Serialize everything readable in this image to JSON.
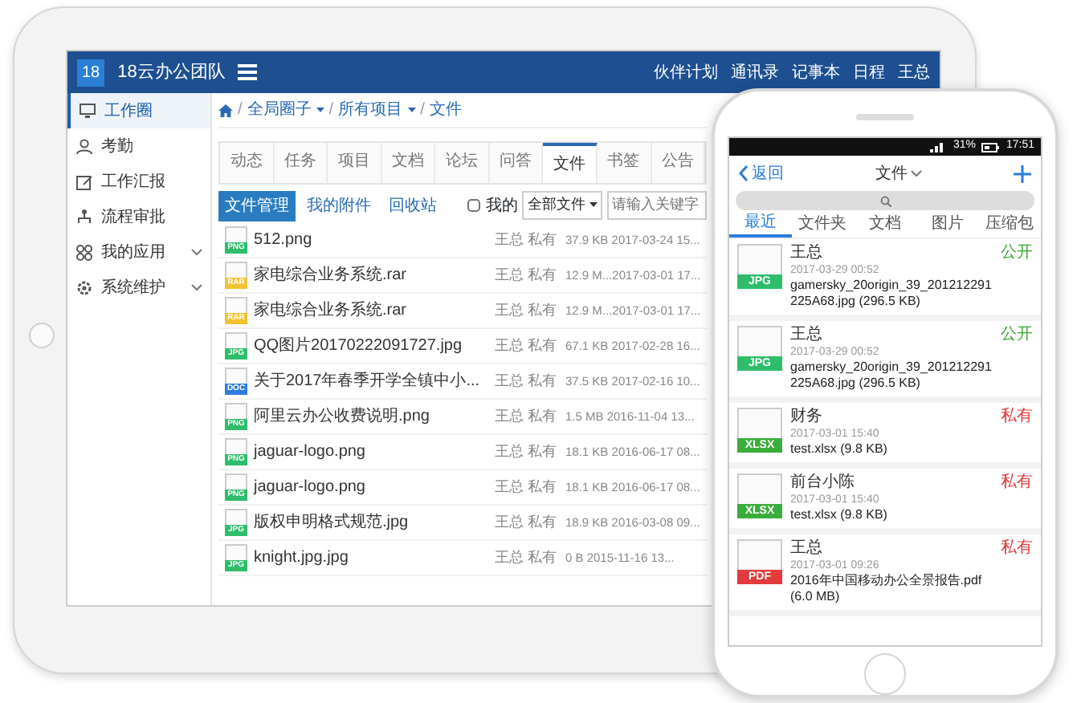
{
  "tablet": {
    "brand": {
      "logo": "18",
      "name": "18云办公团队"
    },
    "nav_links": [
      "伙伴计划",
      "通讯录",
      "记事本",
      "日程",
      "王总"
    ],
    "sidebar": [
      {
        "kind": "monitor",
        "label": "工作圈",
        "selected": true,
        "expandable": false
      },
      {
        "kind": "person",
        "label": "考勤",
        "selected": false,
        "expandable": false
      },
      {
        "kind": "edit",
        "label": "工作汇报",
        "selected": false,
        "expandable": false
      },
      {
        "kind": "flow",
        "label": "流程审批",
        "selected": false,
        "expandable": false
      },
      {
        "kind": "apps",
        "label": "我的应用",
        "selected": false,
        "expandable": true
      },
      {
        "kind": "gear",
        "label": "系统维护",
        "selected": false,
        "expandable": true
      }
    ],
    "breadcrumb_separator": "/",
    "breadcrumb": [
      {
        "label": "全局圈子",
        "dropdown": true
      },
      {
        "label": "所有项目",
        "dropdown": true
      },
      {
        "label": "文件",
        "dropdown": false
      }
    ],
    "tabs": [
      {
        "label": "动态",
        "selected": false
      },
      {
        "label": "任务",
        "selected": false
      },
      {
        "label": "项目",
        "selected": false
      },
      {
        "label": "文档",
        "selected": false
      },
      {
        "label": "论坛",
        "selected": false
      },
      {
        "label": "问答",
        "selected": false
      },
      {
        "label": "文件",
        "selected": true
      },
      {
        "label": "书签",
        "selected": false
      },
      {
        "label": "公告",
        "selected": false
      }
    ],
    "toolbar": {
      "buttons": [
        {
          "label": "文件管理",
          "selected": true
        },
        {
          "label": "我的附件",
          "selected": false
        },
        {
          "label": "回收站",
          "selected": false
        }
      ],
      "mine_filter": {
        "label": "我的",
        "checked": false
      },
      "type_select": "全部文件",
      "search": {
        "placeholder": "请输入关键字"
      }
    },
    "files": [
      {
        "kind": "png",
        "badge": "PNG",
        "name": "512.png",
        "owner": "王总 私有",
        "meta": "37.9 KB 2017-03-24 15..."
      },
      {
        "kind": "rar",
        "badge": "RAR",
        "name": "家电综合业务系统.rar",
        "owner": "王总 私有",
        "meta": "12.9 M...2017-03-01 17..."
      },
      {
        "kind": "rar",
        "badge": "RAR",
        "name": "家电综合业务系统.rar",
        "owner": "王总 私有",
        "meta": "12.9 M...2017-03-01 17..."
      },
      {
        "kind": "jpg",
        "badge": "JPG",
        "name": "QQ图片20170222091727.jpg",
        "owner": "王总 私有",
        "meta": "67.1 KB 2017-02-28 16..."
      },
      {
        "kind": "doc",
        "badge": "DOC",
        "name": "关于2017年春季开学全镇中小...",
        "owner": "王总 私有",
        "meta": "37.5 KB 2017-02-16 10..."
      },
      {
        "kind": "png",
        "badge": "PNG",
        "name": "阿里云办公收费说明.png",
        "owner": "王总 私有",
        "meta": "1.5 MB 2016-11-04 13..."
      },
      {
        "kind": "png",
        "badge": "PNG",
        "name": "jaguar-logo.png",
        "owner": "王总 私有",
        "meta": "18.1 KB 2016-06-17 08..."
      },
      {
        "kind": "png",
        "badge": "PNG",
        "name": "jaguar-logo.png",
        "owner": "王总 私有",
        "meta": "18.1 KB 2016-06-17 08..."
      },
      {
        "kind": "jpg",
        "badge": "JPG",
        "name": "版权申明格式规范.jpg",
        "owner": "王总 私有",
        "meta": "18.9 KB 2016-03-08 09..."
      },
      {
        "kind": "jpg",
        "badge": "JPG",
        "name": "knight.jpg.jpg",
        "owner": "王总 私有",
        "meta": "0 B 2015-11-16 13..."
      }
    ]
  },
  "phone": {
    "status": {
      "battery": "31%",
      "time": "17:51"
    },
    "header": {
      "back": "返回",
      "title": "文件"
    },
    "tabs": [
      {
        "label": "最近",
        "selected": true
      },
      {
        "label": "文件夹",
        "selected": false
      },
      {
        "label": "文档",
        "selected": false
      },
      {
        "label": "图片",
        "selected": false
      },
      {
        "label": "压缩包",
        "selected": false
      }
    ],
    "items": [
      {
        "kind": "jpg",
        "badge": "JPG",
        "owner": "王总",
        "date": "2017-03-29 00:52",
        "file": "gamersky_20origin_39_201212291225A68.jpg (296.5 KB)",
        "visibility": "公开",
        "public": true
      },
      {
        "kind": "jpg",
        "badge": "JPG",
        "owner": "王总",
        "date": "2017-03-29 00:52",
        "file": "gamersky_20origin_39_201212291225A68.jpg (296.5 KB)",
        "visibility": "公开",
        "public": true
      },
      {
        "kind": "xlsx",
        "badge": "XLSX",
        "owner": "财务",
        "date": "2017-03-01 15:40",
        "file": "test.xlsx (9.8 KB)",
        "visibility": "私有",
        "public": false
      },
      {
        "kind": "xlsx",
        "badge": "XLSX",
        "owner": "前台小陈",
        "date": "2017-03-01 15:40",
        "file": "test.xlsx (9.8 KB)",
        "visibility": "私有",
        "public": false
      },
      {
        "kind": "pdf",
        "badge": "PDF",
        "owner": "王总",
        "date": "2017-03-01 09:26",
        "file": "2016年中国移动办公全景报告.pdf (6.0 MB)",
        "visibility": "私有",
        "public": false
      }
    ]
  }
}
